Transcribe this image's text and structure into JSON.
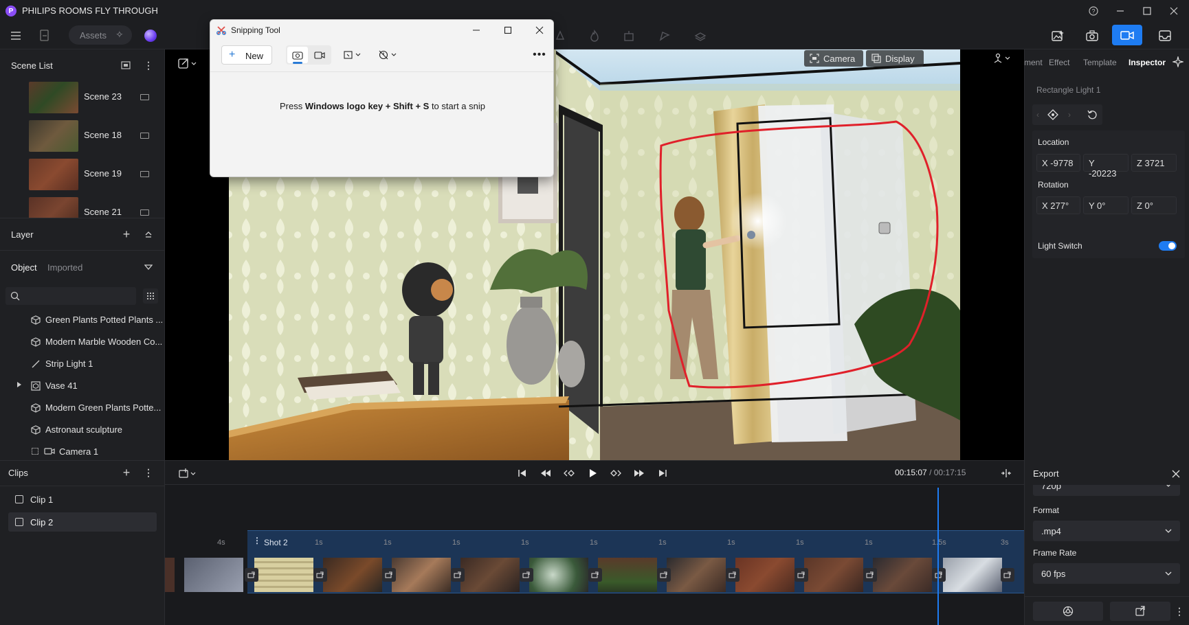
{
  "app": {
    "title": "PHILIPS ROOMS FLY THROUGH"
  },
  "toolbar": {
    "assets_label": "Assets"
  },
  "viewport": {
    "camera_label": "Camera",
    "display_label": "Display"
  },
  "right_tabs": [
    "ment",
    "Effect",
    "Template",
    "Inspector"
  ],
  "inspector": {
    "object_name": "Rectangle Light 1",
    "location_label": "Location",
    "location": {
      "x": "X -9778",
      "y": "Y -20223",
      "z": "Z 3721"
    },
    "rotation_label": "Rotation",
    "rotation": {
      "x": "X 277°",
      "y": "Y 0°",
      "z": "Z 0°"
    },
    "light_switch_label": "Light Switch",
    "light_switch_on": true
  },
  "scene_list": {
    "title": "Scene List",
    "items": [
      {
        "label": "Scene 23"
      },
      {
        "label": "Scene 18"
      },
      {
        "label": "Scene 19"
      },
      {
        "label": "Scene 21"
      }
    ]
  },
  "layer": {
    "title": "Layer",
    "tab_object": "Object",
    "tab_imported": "Imported",
    "items": [
      {
        "label": "Green Plants Potted Plants ...",
        "icon": "cube-icon"
      },
      {
        "label": "Modern Marble Wooden Co...",
        "icon": "cube-icon"
      },
      {
        "label": "Strip Light 1",
        "icon": "line-icon"
      },
      {
        "label": "Vase 41",
        "icon": "group-icon"
      },
      {
        "label": "Modern Green Plants Potte...",
        "icon": "cube-icon"
      },
      {
        "label": "Astronaut sculpture",
        "icon": "cube-icon"
      },
      {
        "label": "Camera 1",
        "icon": "camera-icon"
      }
    ]
  },
  "clips": {
    "title": "Clips",
    "items": [
      {
        "label": "Clip 1"
      },
      {
        "label": "Clip 2"
      }
    ]
  },
  "playback": {
    "current_time": "00:15:07",
    "separator": "/",
    "total_time": "00:17:15"
  },
  "timeline": {
    "shot_label": "Shot 2",
    "left_tick": "4s",
    "ticks": [
      "1s",
      "1s",
      "1s",
      "1s",
      "1s",
      "1s",
      "1s",
      "1s",
      "1s",
      "1.5s",
      "3s"
    ]
  },
  "export": {
    "title": "Export",
    "resolution_value": "720p",
    "format_label": "Format",
    "format_value": ".mp4",
    "frame_rate_label": "Frame Rate",
    "frame_rate_value": "60 fps"
  },
  "snipping_tool": {
    "title": "Snipping Tool",
    "new_label": "New",
    "hint_prefix": "Press ",
    "hint_bold": "Windows logo key + Shift + S",
    "hint_suffix": " to start a snip"
  },
  "colors": {
    "accent": "#1e7cf2",
    "annotation": "#e0202a",
    "timeline_band": "#1c3556"
  }
}
